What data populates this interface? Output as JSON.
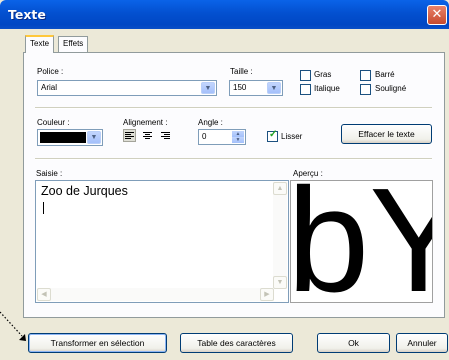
{
  "window": {
    "title": "Texte",
    "close_glyph": "✕"
  },
  "tabs": [
    {
      "label": "Texte",
      "active": true
    },
    {
      "label": "Effets",
      "active": false
    }
  ],
  "police": {
    "label": "Police :",
    "value": "Arial"
  },
  "taille": {
    "label": "Taille :",
    "value": "150"
  },
  "checkboxes": {
    "gras": {
      "label": "Gras",
      "checked": false
    },
    "italique": {
      "label": "Italique",
      "checked": false
    },
    "barre": {
      "label": "Barré",
      "checked": false
    },
    "souligne": {
      "label": "Souligné",
      "checked": false
    },
    "lisser": {
      "label": "Lisser",
      "checked": true
    }
  },
  "couleur": {
    "label": "Couleur :",
    "value_color": "#000000"
  },
  "alignement": {
    "label": "Alignement :",
    "options": [
      "left",
      "center",
      "right"
    ],
    "selected": "left"
  },
  "angle": {
    "label": "Angle :",
    "value": "0"
  },
  "effacer_button": "Effacer le texte",
  "saisie": {
    "label": "Saisie :",
    "text": "Zoo de Jurques"
  },
  "apercu": {
    "label": "Aperçu :",
    "text": "bY"
  },
  "buttons": {
    "transformer": "Transformer en sélection",
    "table": "Table des caractères",
    "ok": "Ok",
    "annuler": "Annuler"
  },
  "colors": {
    "titlebar": "#0350d0",
    "dialog_bg": "#ece9d8",
    "tab_highlight": "#ffc83c"
  }
}
